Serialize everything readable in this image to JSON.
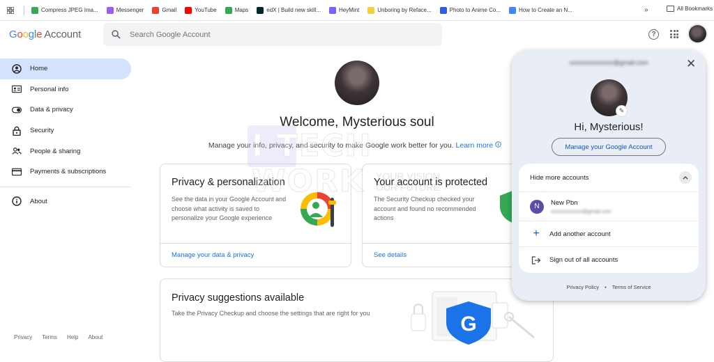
{
  "bookmarks": {
    "items": [
      {
        "label": "Compress JPEG Ima...",
        "color": "#3aa757"
      },
      {
        "label": "Messenger",
        "color": "#9b5cf6"
      },
      {
        "label": "Gmail",
        "color": "#ea4335"
      },
      {
        "label": "YouTube",
        "color": "#ff0000"
      },
      {
        "label": "Maps",
        "color": "#34a853"
      },
      {
        "label": "edX | Build new skill...",
        "color": "#02262b"
      },
      {
        "label": "HeyMint",
        "color": "#7b61ff"
      },
      {
        "label": "Unboring by Reface...",
        "color": "#f4d03f"
      },
      {
        "label": "Photo to Anime Co...",
        "color": "#2f5bea"
      },
      {
        "label": "How to Create an N...",
        "color": "#4285f4"
      }
    ],
    "more": "»",
    "all_bookmarks": "All Bookmarks"
  },
  "header": {
    "logo_google": "Google",
    "logo_account": "Account",
    "search_placeholder": "Search Google Account",
    "help_icon_glyph": "?"
  },
  "sidebar": {
    "items": [
      {
        "label": "Home",
        "icon": "home-icon",
        "active": true
      },
      {
        "label": "Personal info",
        "icon": "id-card-icon"
      },
      {
        "label": "Data & privacy",
        "icon": "toggle-icon"
      },
      {
        "label": "Security",
        "icon": "lock-icon"
      },
      {
        "label": "People & sharing",
        "icon": "people-icon"
      },
      {
        "label": "Payments & subscriptions",
        "icon": "credit-card-icon"
      }
    ],
    "about": "About",
    "footer": [
      "Privacy",
      "Terms",
      "Help",
      "About"
    ]
  },
  "main": {
    "welcome": "Welcome, Mysterious soul",
    "subtitle": "Manage your info, privacy, and security to make Google work better for you.",
    "learn_more": "Learn more",
    "cards": {
      "privacy": {
        "title": "Privacy & personalization",
        "body": "See the data in your Google Account and choose what activity is saved to personalize your Google experience",
        "link": "Manage your data & privacy"
      },
      "security": {
        "title": "Your account is protected",
        "body": "The Security Checkup checked your account and found no recommended actions",
        "link": "See details"
      },
      "suggestions": {
        "title": "Privacy suggestions available",
        "body": "Take the Privacy Checkup and choose the settings that are right for you"
      }
    }
  },
  "watermark": {
    "big": "I TECH WORK",
    "line1": "YOUR VISION",
    "line2": "OUR FUTURE"
  },
  "panel": {
    "greeting": "Hi, Mysterious!",
    "manage_button": "Manage your Google Account",
    "hide_accounts": "Hide more accounts",
    "account_name": "New Pbn",
    "account_initial": "N",
    "add_account": "Add another account",
    "sign_out": "Sign out of all accounts",
    "privacy_policy": "Privacy Policy",
    "bullet": "•",
    "terms": "Terms of Service",
    "close_glyph": "✕"
  }
}
